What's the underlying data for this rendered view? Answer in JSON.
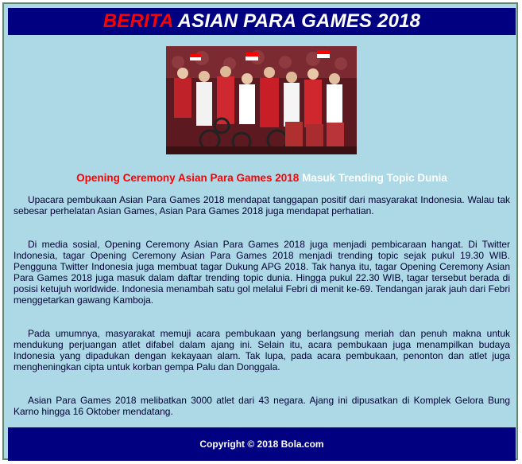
{
  "header": {
    "title_accent": "BERITA",
    "title_rest": "ASIAN PARA GAMES 2018"
  },
  "photo": {
    "description_icon": "ceremony-photo"
  },
  "headline": {
    "red_part": "Opening Ceremony Asian Para Games 2018",
    "white_part": "Masuk Trending Topic Dunia"
  },
  "article": {
    "paragraphs": [
      "Upacara pembukaan Asian Para Games 2018 mendapat tanggapan positif dari masyarakat Indonesia. Walau tak sebesar perhelatan Asian Games, Asian Para Games 2018 juga mendapat perhatian.",
      "Di media sosial, Opening Ceremony Asian Para Games 2018 juga menjadi pembicaraan hangat. Di Twitter Indonesia, tagar Opening Ceremony Asian Para Games 2018 menjadi trending topic sejak pukul 19.30 WIB. Pengguna Twitter Indonesia juga membuat tagar Dukung APG 2018. Tak hanya itu, tagar Opening Ceremony Asian Para Games 2018 juga masuk dalam daftar trending topic dunia. Hingga pukul 22.30 WIB, tagar tersebut berada di posisi ketujuh worldwide. Indonesia menambah satu gol melalui Febri di menit ke-69. Tendangan jarak jauh dari Febri menggetarkan gawang Kamboja.",
      "Pada umumnya, masyarakat memuji acara pembukaan yang berlangsung meriah dan penuh makna untuk mendukung perjuangan atlet difabel dalam ajang ini. Selain itu, acara pembukaan juga menampilkan budaya Indonesia yang dipadukan dengan kekayaan alam. Tak lupa, pada acara pembukaan, penonton dan atlet juga mengheningkan cipta untuk korban gempa Palu dan Donggala.",
      "Asian Para Games 2018 melibatkan 3000 atlet dari 43 negara. Ajang ini dipusatkan di Komplek Gelora Bung Karno hingga 16 Oktober mendatang."
    ]
  },
  "footer": {
    "copyright": "Copyright © 2018 Bola.com"
  },
  "colors": {
    "page_bg": "#add8e6",
    "bar_bg": "#000080",
    "accent_red": "#ff0000",
    "white": "#ffffff"
  }
}
